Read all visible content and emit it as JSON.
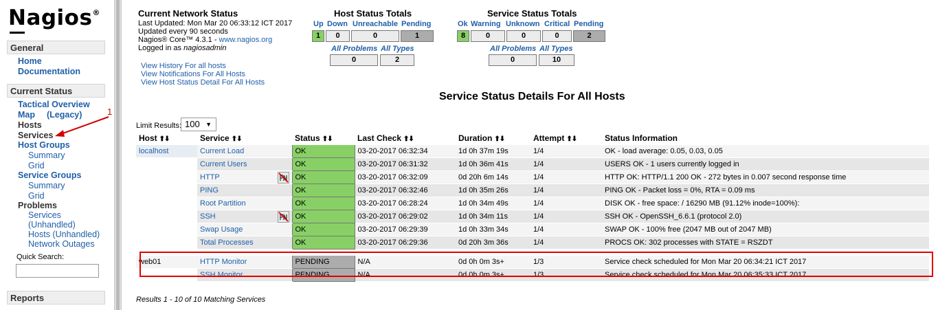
{
  "logo": "Nagios",
  "sidebar": {
    "general": "General",
    "general_links": [
      "Home",
      "Documentation"
    ],
    "current_status": "Current Status",
    "tactical": "Tactical Overview",
    "map": "Map",
    "legacy": "(Legacy)",
    "hosts": "Hosts",
    "services": "Services",
    "host_groups": "Host Groups",
    "hg_summary": "Summary",
    "hg_grid": "Grid",
    "service_groups": "Service Groups",
    "sg_summary": "Summary",
    "sg_grid": "Grid",
    "problems": "Problems",
    "p_services": "Services",
    "p_unhandled": "(Unhandled)",
    "p_hosts": "Hosts (Unhandled)",
    "p_outages": "Network Outages",
    "quick_search": "Quick Search:",
    "reports": "Reports",
    "annotation_number": "1"
  },
  "status_info": {
    "title": "Current Network Status",
    "last_updated": "Last Updated: Mon Mar 20 06:33:12 ICT 2017",
    "update_every": "Updated every 90 seconds",
    "core_prefix": "Nagios® Core™ 4.3.1 - ",
    "core_link": "www.nagios.org",
    "logged_in_prefix": "Logged in as ",
    "logged_in_user": "nagiosadmin",
    "links": [
      "View History For all hosts",
      "View Notifications For All Hosts",
      "View Host Status Detail For All Hosts"
    ]
  },
  "host_totals": {
    "title": "Host Status Totals",
    "headers": [
      "Up",
      "Down",
      "Unreachable",
      "Pending"
    ],
    "values": [
      "1",
      "0",
      "0",
      "1"
    ],
    "sub_headers": [
      "All Problems",
      "All Types"
    ],
    "sub_values": [
      "0",
      "2"
    ]
  },
  "service_totals": {
    "title": "Service Status Totals",
    "headers": [
      "Ok",
      "Warning",
      "Unknown",
      "Critical",
      "Pending"
    ],
    "values": [
      "8",
      "0",
      "0",
      "0",
      "2"
    ],
    "sub_headers": [
      "All Problems",
      "All Types"
    ],
    "sub_values": [
      "0",
      "10"
    ]
  },
  "page_title": "Service Status Details For All Hosts",
  "limit": {
    "label": "Limit Results:",
    "value": "100"
  },
  "table": {
    "headers": [
      "Host",
      "Service",
      "Status",
      "Last Check",
      "Duration",
      "Attempt",
      "Status Information"
    ],
    "rows": [
      {
        "host": "localhost",
        "service": "Current Load",
        "status": "OK",
        "last_check": "03-20-2017 06:32:34",
        "duration": "1d 0h 37m 19s",
        "attempt": "1/4",
        "info": "OK - load average: 0.05, 0.03, 0.05"
      },
      {
        "host": "",
        "service": "Current Users",
        "status": "OK",
        "last_check": "03-20-2017 06:31:32",
        "duration": "1d 0h 36m 41s",
        "attempt": "1/4",
        "info": "USERS OK - 1 users currently logged in"
      },
      {
        "host": "",
        "service": "HTTP",
        "status": "OK",
        "last_check": "03-20-2017 06:32:09",
        "duration": "0d 20h 6m 14s",
        "attempt": "1/4",
        "info": "HTTP OK: HTTP/1.1 200 OK - 272 bytes in 0.007 second response time"
      },
      {
        "host": "",
        "service": "PING",
        "status": "OK",
        "last_check": "03-20-2017 06:32:46",
        "duration": "1d 0h 35m 26s",
        "attempt": "1/4",
        "info": "PING OK - Packet loss = 0%, RTA = 0.09 ms"
      },
      {
        "host": "",
        "service": "Root Partition",
        "status": "OK",
        "last_check": "03-20-2017 06:28:24",
        "duration": "1d 0h 34m 49s",
        "attempt": "1/4",
        "info": "DISK OK - free space: / 16290 MB (91.12% inode=100%):"
      },
      {
        "host": "",
        "service": "SSH",
        "status": "OK",
        "last_check": "03-20-2017 06:29:02",
        "duration": "1d 0h 34m 11s",
        "attempt": "1/4",
        "info": "SSH OK - OpenSSH_6.6.1 (protocol 2.0)"
      },
      {
        "host": "",
        "service": "Swap Usage",
        "status": "OK",
        "last_check": "03-20-2017 06:29:39",
        "duration": "1d 0h 33m 34s",
        "attempt": "1/4",
        "info": "SWAP OK - 100% free (2047 MB out of 2047 MB)"
      },
      {
        "host": "",
        "service": "Total Processes",
        "status": "OK",
        "last_check": "03-20-2017 06:29:36",
        "duration": "0d 20h 3m 36s",
        "attempt": "1/4",
        "info": "PROCS OK: 302 processes with STATE = RSZDT"
      },
      {
        "host": "web01",
        "service": "HTTP Monitor",
        "status": "PENDING",
        "last_check": "N/A",
        "duration": "0d 0h 0m 3s+",
        "attempt": "1/3",
        "info": "Service check scheduled for Mon Mar 20 06:34:21 ICT 2017"
      },
      {
        "host": "",
        "service": "SSH Monitor",
        "status": "PENDING",
        "last_check": "N/A",
        "duration": "0d 0h 0m 3s+",
        "attempt": "1/3",
        "info": "Service check scheduled for Mon Mar 20 06:35:33 ICT 2017"
      }
    ]
  },
  "results_text": "Results 1 - 10 of 10 Matching Services",
  "colors": {
    "ok": "#88d066",
    "pending": "#acacac",
    "link": "#1f5fa8",
    "highlight": "#e00000"
  }
}
